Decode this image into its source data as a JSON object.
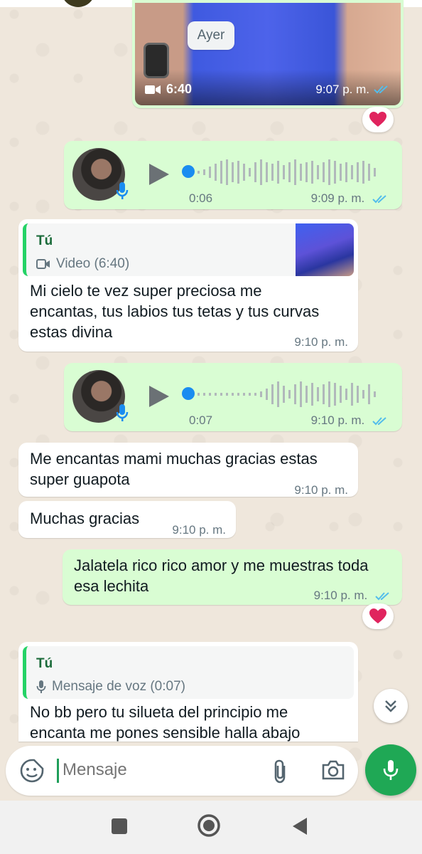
{
  "date_chip": "Ayer",
  "messages": {
    "video": {
      "duration": "6:40",
      "time": "9:07 p. m."
    },
    "voice1": {
      "duration": "0:06",
      "time": "9:09 p. m."
    },
    "reply1": {
      "quote_author": "Tú",
      "quote_text": "Video (6:40)",
      "text": "Mi cielo te vez super preciosa me encantas, tus labios tus tetas y tus curvas estas divina",
      "time": "9:10 p. m."
    },
    "voice2": {
      "duration": "0:07",
      "time": "9:10 p. m."
    },
    "in2": {
      "text": "Me encantas mami muchas gracias estas super guapota",
      "time": "9:10 p. m."
    },
    "in3": {
      "text": "Muchas gracias",
      "time": "9:10 p. m."
    },
    "out4": {
      "text": "Jalatela rico rico amor y me muestras toda esa lechita",
      "time": "9:10 p. m."
    },
    "reply2": {
      "quote_author": "Tú",
      "quote_text": "Mensaje de voz (0:07)",
      "text": "No bb pero tu silueta del principio me encanta me pones sensible halla abajo"
    }
  },
  "composer": {
    "placeholder": "Mensaje"
  },
  "colors": {
    "outgoing": "#d9fdd3",
    "incoming": "#ffffff",
    "accent": "#1fa855",
    "read_ticks": "#53bdeb"
  },
  "icons": [
    "video-camera-icon",
    "read-ticks-icon",
    "heart-reaction-icon",
    "play-icon",
    "mic-icon",
    "sticker-icon",
    "paperclip-icon",
    "camera-icon",
    "chevron-double-down-icon",
    "nav-square-icon",
    "nav-circle-icon",
    "nav-back-icon"
  ]
}
